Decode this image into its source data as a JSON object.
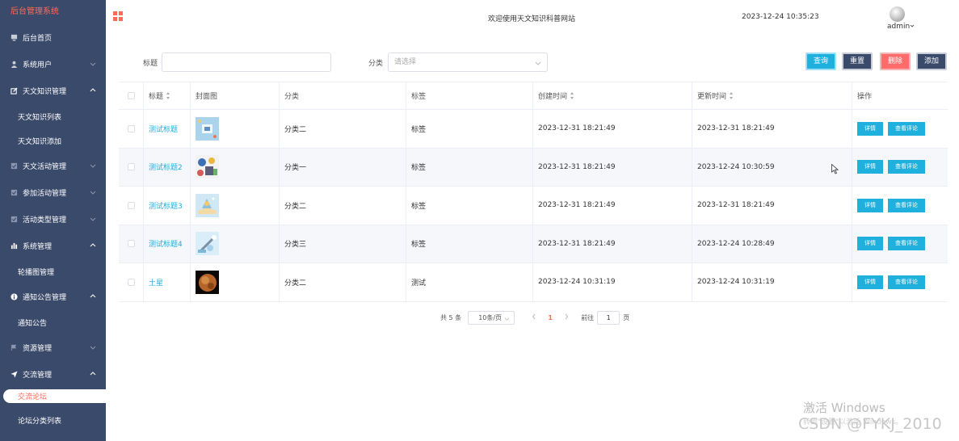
{
  "sidebar": {
    "brand": "后台管理系统",
    "items": [
      {
        "label": "后台首页",
        "icon": "monitor-icon"
      },
      {
        "label": "系统用户",
        "icon": "user-icon"
      },
      {
        "label": "天文知识管理",
        "icon": "edit-icon"
      },
      {
        "label": "天文知识列表"
      },
      {
        "label": "天文知识添加"
      },
      {
        "label": "天文活动管理",
        "icon": "checkbox-icon"
      },
      {
        "label": "参加活动管理",
        "icon": "checkbox-icon"
      },
      {
        "label": "活动类型管理",
        "icon": "checkbox-icon"
      },
      {
        "label": "系统管理",
        "icon": "bar-chart-icon"
      },
      {
        "label": "轮播图管理"
      },
      {
        "label": "通知公告管理",
        "icon": "info-icon"
      },
      {
        "label": "通知公告"
      },
      {
        "label": "资源管理",
        "icon": "flag-icon"
      },
      {
        "label": "交流管理",
        "icon": "send-icon"
      },
      {
        "label": "交流论坛"
      },
      {
        "label": "论坛分类列表"
      }
    ]
  },
  "header": {
    "title": "欢迎使用天文知识科普网站",
    "datetime": "2023-12-24 10:35:23",
    "user": "admin"
  },
  "search": {
    "title_label": "标题",
    "title_value": "",
    "category_label": "分类",
    "category_placeholder": "请选择",
    "query_label": "查询",
    "reset_label": "重置",
    "delete_label": "删除",
    "add_label": "添加"
  },
  "table": {
    "columns": [
      "标题",
      "封面图",
      "分类",
      "标签",
      "创建时间",
      "更新时间",
      "操作"
    ],
    "rows": [
      {
        "title": "测试标题",
        "category": "分类二",
        "tag": "标签",
        "created": "2023-12-31 18:21:49",
        "updated": "2023-12-31 18:21:49"
      },
      {
        "title": "测试标题2",
        "category": "分类一",
        "tag": "标签",
        "created": "2023-12-31 18:21:49",
        "updated": "2023-12-24 10:30:59"
      },
      {
        "title": "测试标题3",
        "category": "分类二",
        "tag": "标签",
        "created": "2023-12-31 18:21:49",
        "updated": "2023-12-31 18:21:49"
      },
      {
        "title": "测试标题4",
        "category": "分类三",
        "tag": "标签",
        "created": "2023-12-31 18:21:49",
        "updated": "2023-12-24 10:28:49"
      },
      {
        "title": "土星",
        "category": "分类二",
        "tag": "测试",
        "created": "2023-12-24 10:31:19",
        "updated": "2023-12-24 10:31:19"
      }
    ],
    "op_detail": "详情",
    "op_comments": "查看评论"
  },
  "pagination": {
    "total": "共 5 条",
    "page_size": "10条/页",
    "current_page": "1",
    "goto_label": "前往",
    "goto_value": "1",
    "page_suffix": "页"
  },
  "overlay": {
    "windows_activate": "激活 Windows",
    "windows_hint": "转到\"设置\"以激活 Windows。",
    "csdn": "CSDN @FYKJ_2010"
  }
}
